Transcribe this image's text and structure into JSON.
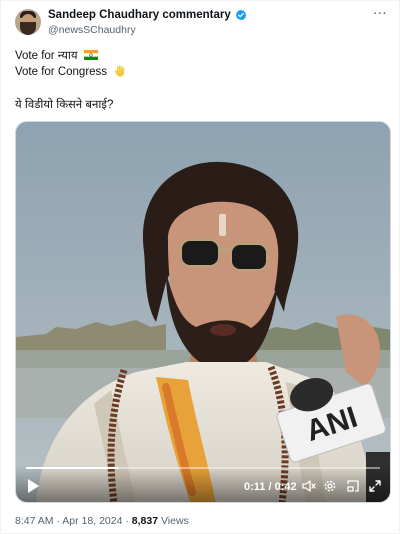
{
  "author": {
    "display_name": "Sandeep Chaudhary commentary",
    "handle": "@newsSChaudhry",
    "verified": true
  },
  "post": {
    "line1_text": "Vote for न्याय",
    "line1_emoji": "india-flag-icon",
    "line2_text": "Vote for Congress",
    "line2_emoji": "raised-hand-icon",
    "line3_text": "ये विडीयो किसने बनाई?"
  },
  "video": {
    "logo_text": "ANI",
    "elapsed": "0:11",
    "separator": "/",
    "duration": "0:42",
    "progress_fraction": 0.26,
    "controls": [
      "play-icon",
      "volume-icon",
      "settings-icon",
      "pip-icon",
      "fullscreen-icon"
    ]
  },
  "meta": {
    "time": "8:47 AM",
    "separator": "·",
    "date": "Apr 18, 2024",
    "views_count": "8,837",
    "views_label": "Views"
  },
  "colors": {
    "text": "#0f1419",
    "secondary": "#536471",
    "verified": "#1d9bf0",
    "border": "#cfd9de"
  }
}
